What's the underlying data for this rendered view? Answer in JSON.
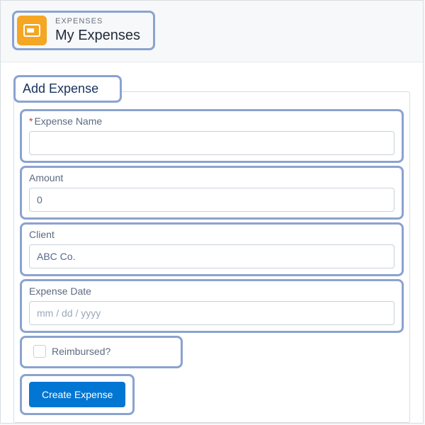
{
  "header": {
    "eyebrow": "EXPENSES",
    "title": "My Expenses"
  },
  "section": {
    "title": "Add Expense"
  },
  "fields": {
    "expense_name": {
      "label": "Expense Name",
      "value": "",
      "required": true
    },
    "amount": {
      "label": "Amount",
      "value": "0"
    },
    "client": {
      "label": "Client",
      "value": "ABC Co."
    },
    "expense_date": {
      "label": "Expense Date",
      "placeholder": "mm / dd / yyyy",
      "value": ""
    },
    "reimbursed": {
      "label": "Reimbursed?",
      "checked": false
    }
  },
  "actions": {
    "create": "Create Expense"
  },
  "colors": {
    "highlight_border": "#8aa3d0",
    "primary_button": "#0176d3",
    "app_icon": "#f5a623"
  }
}
